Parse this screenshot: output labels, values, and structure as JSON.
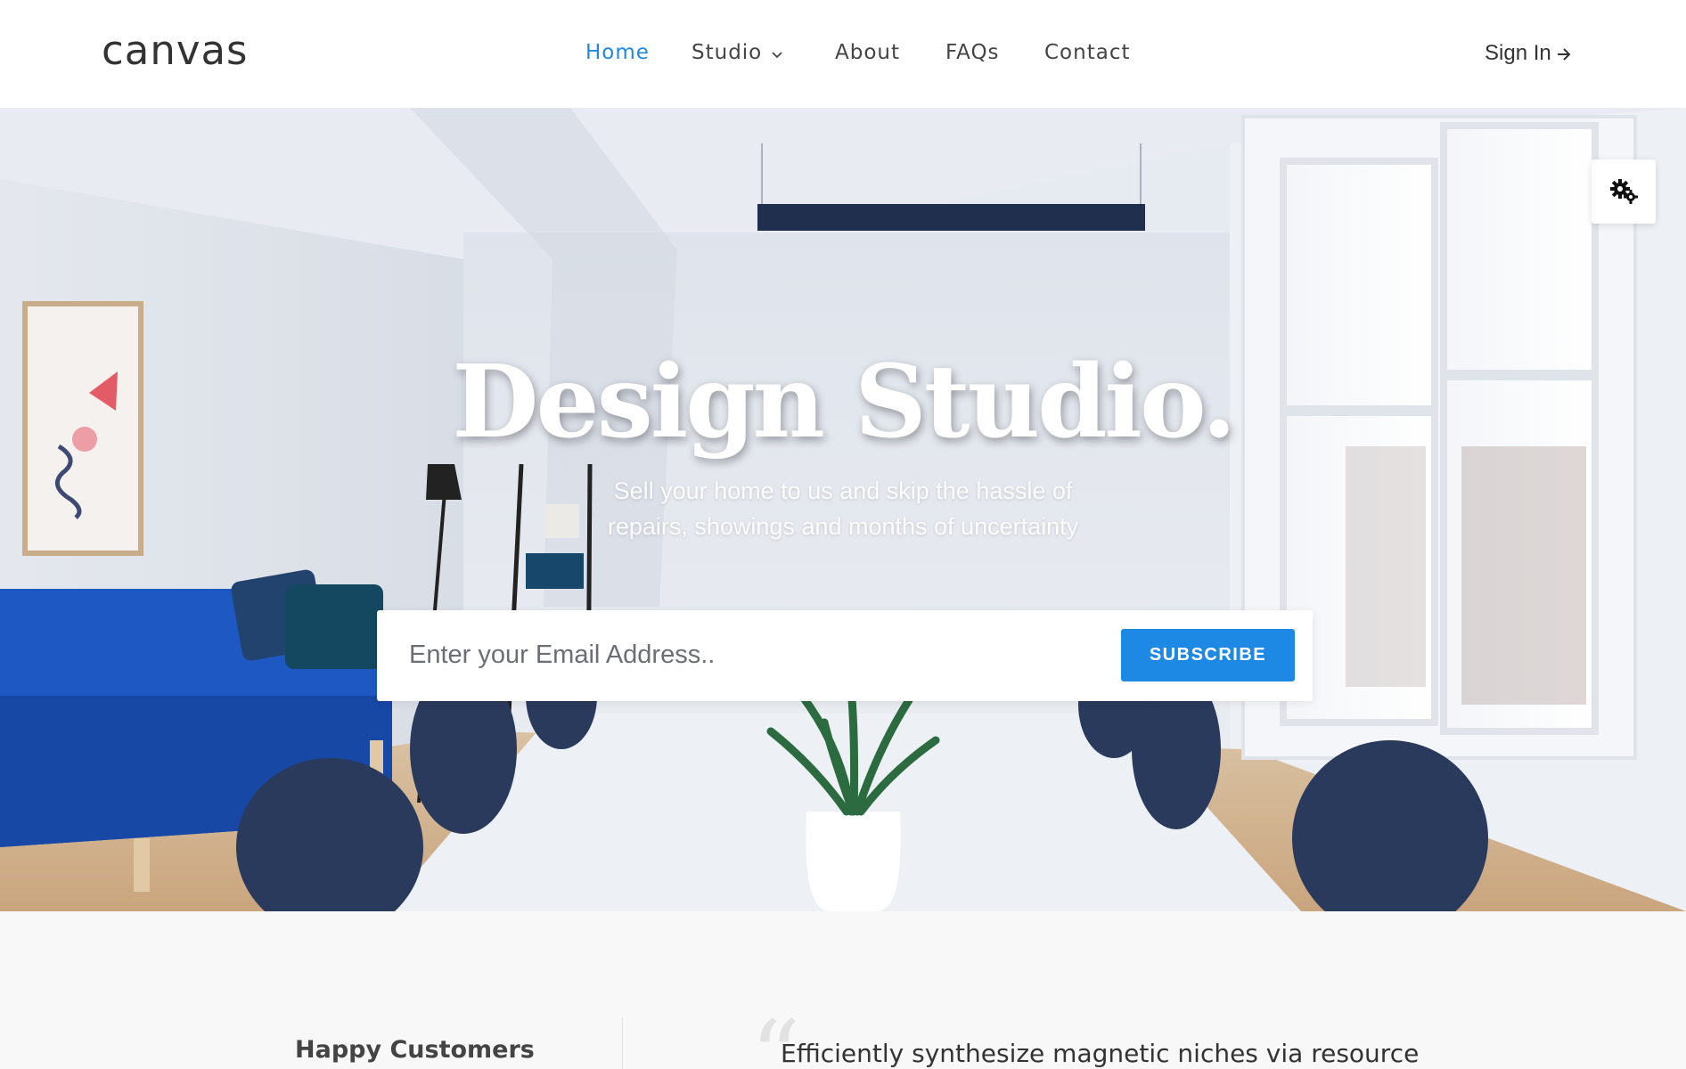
{
  "header": {
    "logo": "canvas",
    "nav": [
      {
        "label": "Home",
        "active": true
      },
      {
        "label": "Studio",
        "active": false,
        "has_dropdown": true
      },
      {
        "label": "About",
        "active": false
      },
      {
        "label": "FAQs",
        "active": false
      },
      {
        "label": "Contact",
        "active": false
      }
    ],
    "sign_in": "Sign In"
  },
  "hero": {
    "title": "Design Studio.",
    "subtitle_line1": "Sell your home to us and skip the hassle of",
    "subtitle_line2": "repairs, showings and months of uncertainty",
    "email_placeholder": "Enter your Email Address..",
    "subscribe_label": "SUBSCRIBE",
    "settings_icon": "gears-icon"
  },
  "testimonials": {
    "heading": "Happy Customers",
    "quote_mark": "“",
    "quote": "Efficiently synthesize magnetic niches via resource"
  },
  "colors": {
    "accent": "#1e88e5",
    "text": "#333333",
    "section_bg": "#f8f8f8"
  }
}
